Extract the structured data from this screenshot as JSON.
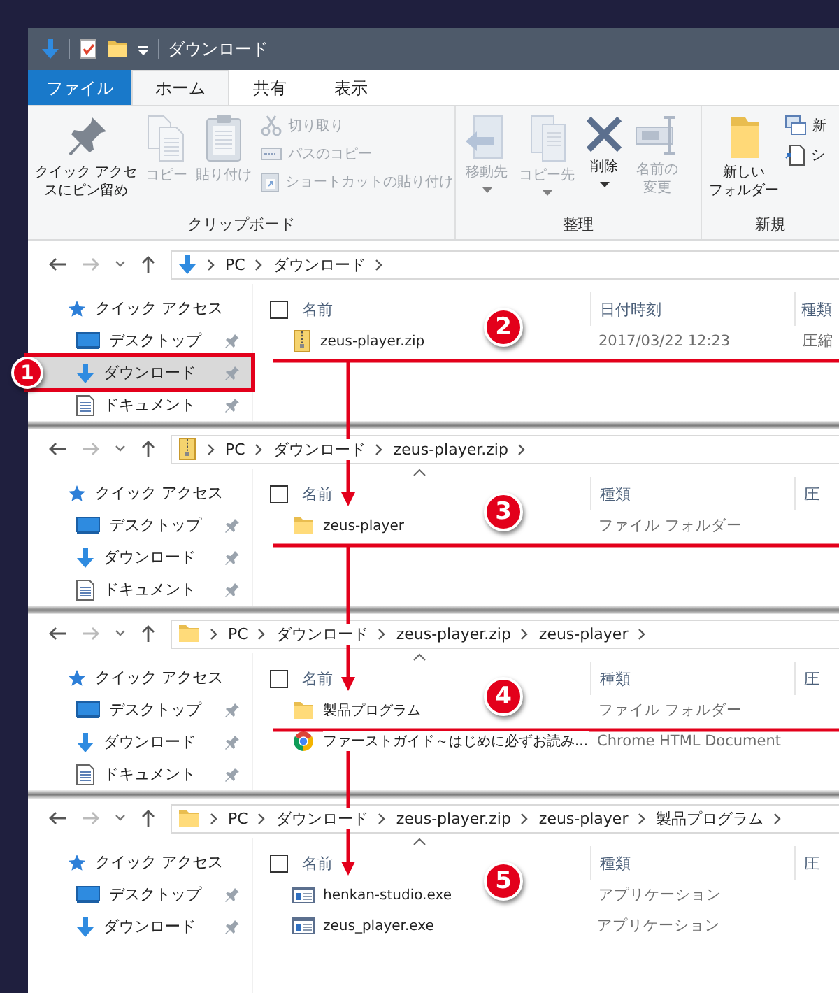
{
  "title_bar": {
    "title": "ダウンロード"
  },
  "ribbon_tabs": [
    {
      "label": "ファイル",
      "kind": "menu",
      "selected": false
    },
    {
      "label": "ホーム",
      "kind": "tab",
      "selected": true
    },
    {
      "label": "共有",
      "kind": "tab",
      "selected": false
    },
    {
      "label": "表示",
      "kind": "tab",
      "selected": false
    }
  ],
  "ribbon_groups": [
    {
      "label": "クリップボード",
      "items": [
        {
          "lines": [
            "クイック アクセ",
            "スにピン留め"
          ],
          "kind": "large",
          "disabled": false,
          "dropdown": false
        },
        {
          "lines": [
            "コピー"
          ],
          "kind": "large",
          "disabled": true,
          "dropdown": false
        },
        {
          "lines": [
            "貼り付け"
          ],
          "kind": "large",
          "disabled": true,
          "dropdown": false
        },
        {
          "label": "切り取り",
          "kind": "small",
          "disabled": true
        },
        {
          "label": "パスのコピー",
          "kind": "small",
          "disabled": true
        },
        {
          "label": "ショートカットの貼り付け",
          "kind": "small",
          "disabled": true
        }
      ]
    },
    {
      "label": "整理",
      "items": [
        {
          "lines": [
            "移動先"
          ],
          "kind": "large",
          "disabled": true,
          "dropdown": true
        },
        {
          "lines": [
            "コピー先"
          ],
          "kind": "large",
          "disabled": true,
          "dropdown": true
        },
        {
          "lines": [
            "削除"
          ],
          "kind": "large",
          "disabled": false,
          "dropdown": true
        },
        {
          "lines": [
            "名前の",
            "変更"
          ],
          "kind": "large",
          "disabled": true,
          "dropdown": false
        }
      ]
    },
    {
      "label": "新規",
      "items": [
        {
          "lines": [
            "新しい",
            "フォルダー"
          ],
          "kind": "large",
          "disabled": false,
          "dropdown": false
        },
        {
          "label": "新",
          "kind": "small",
          "disabled": false
        },
        {
          "label": "シ",
          "kind": "small",
          "disabled": false
        }
      ]
    }
  ],
  "views": [
    {
      "location": {
        "kind": "downloads"
      },
      "path": [
        "PC",
        "ダウンロード"
      ],
      "nav": [
        {
          "label": "クイック アクセス",
          "kind": "quick",
          "pinned": false,
          "selected": false,
          "highlighted": false
        },
        {
          "label": "デスクトップ",
          "kind": "desktop",
          "pinned": true,
          "selected": false,
          "highlighted": false
        },
        {
          "label": "ダウンロード",
          "kind": "downloads",
          "pinned": true,
          "selected": true,
          "highlighted": true,
          "callout": "1"
        },
        {
          "label": "ドキュメント",
          "kind": "documents",
          "pinned": true,
          "selected": false,
          "highlighted": false
        }
      ],
      "all_checked": false,
      "sort_arrow": false,
      "columns": [
        "名前",
        "日付時刻",
        "種類"
      ],
      "files": [
        {
          "kind": "zip",
          "cells": [
            "zeus-player.zip",
            "2017/03/22 12:23",
            "圧縮"
          ]
        }
      ],
      "callout": "2"
    },
    {
      "location": {
        "kind": "zip"
      },
      "path": [
        "PC",
        "ダウンロード",
        "zeus-player.zip"
      ],
      "nav": [
        {
          "label": "クイック アクセス",
          "kind": "quick",
          "pinned": false,
          "selected": false,
          "highlighted": false
        },
        {
          "label": "デスクトップ",
          "kind": "desktop",
          "pinned": true,
          "selected": false,
          "highlighted": false
        },
        {
          "label": "ダウンロード",
          "kind": "downloads",
          "pinned": true,
          "selected": false,
          "highlighted": false
        },
        {
          "label": "ドキュメント",
          "kind": "documents",
          "pinned": true,
          "selected": false,
          "highlighted": false
        }
      ],
      "all_checked": false,
      "sort_arrow": true,
      "columns": [
        "名前",
        "種類",
        "圧"
      ],
      "files": [
        {
          "kind": "folder",
          "cells": [
            "zeus-player",
            "ファイル フォルダー"
          ]
        }
      ],
      "callout": "3"
    },
    {
      "location": {
        "kind": "folder"
      },
      "path": [
        "PC",
        "ダウンロード",
        "zeus-player.zip",
        "zeus-player"
      ],
      "nav": [
        {
          "label": "クイック アクセス",
          "kind": "quick",
          "pinned": false,
          "selected": false,
          "highlighted": false
        },
        {
          "label": "デスクトップ",
          "kind": "desktop",
          "pinned": true,
          "selected": false,
          "highlighted": false
        },
        {
          "label": "ダウンロード",
          "kind": "downloads",
          "pinned": true,
          "selected": false,
          "highlighted": false
        },
        {
          "label": "ドキュメント",
          "kind": "documents",
          "pinned": true,
          "selected": false,
          "highlighted": false
        }
      ],
      "all_checked": false,
      "sort_arrow": true,
      "columns": [
        "名前",
        "種類",
        "圧"
      ],
      "files": [
        {
          "kind": "folder",
          "cells": [
            "製品プログラム",
            "ファイル フォルダー"
          ]
        },
        {
          "kind": "html",
          "cells": [
            "ファーストガイド～はじめに必ずお読み...",
            "Chrome HTML Document"
          ]
        }
      ],
      "callout": "4"
    },
    {
      "location": {
        "kind": "folder"
      },
      "path": [
        "PC",
        "ダウンロード",
        "zeus-player.zip",
        "zeus-player",
        "製品プログラム"
      ],
      "nav": [
        {
          "label": "クイック アクセス",
          "kind": "quick",
          "pinned": false,
          "selected": false,
          "highlighted": false
        },
        {
          "label": "デスクトップ",
          "kind": "desktop",
          "pinned": true,
          "selected": false,
          "highlighted": false
        },
        {
          "label": "ダウンロード",
          "kind": "downloads",
          "pinned": true,
          "selected": false,
          "highlighted": false
        }
      ],
      "all_checked": false,
      "sort_arrow": true,
      "columns": [
        "名前",
        "種類",
        "圧"
      ],
      "files": [
        {
          "kind": "exe",
          "cells": [
            "henkan-studio.exe",
            "アプリケーション"
          ]
        },
        {
          "kind": "exe",
          "cells": [
            "zeus_player.exe",
            "アプリケーション"
          ]
        }
      ],
      "callout": "5"
    }
  ]
}
